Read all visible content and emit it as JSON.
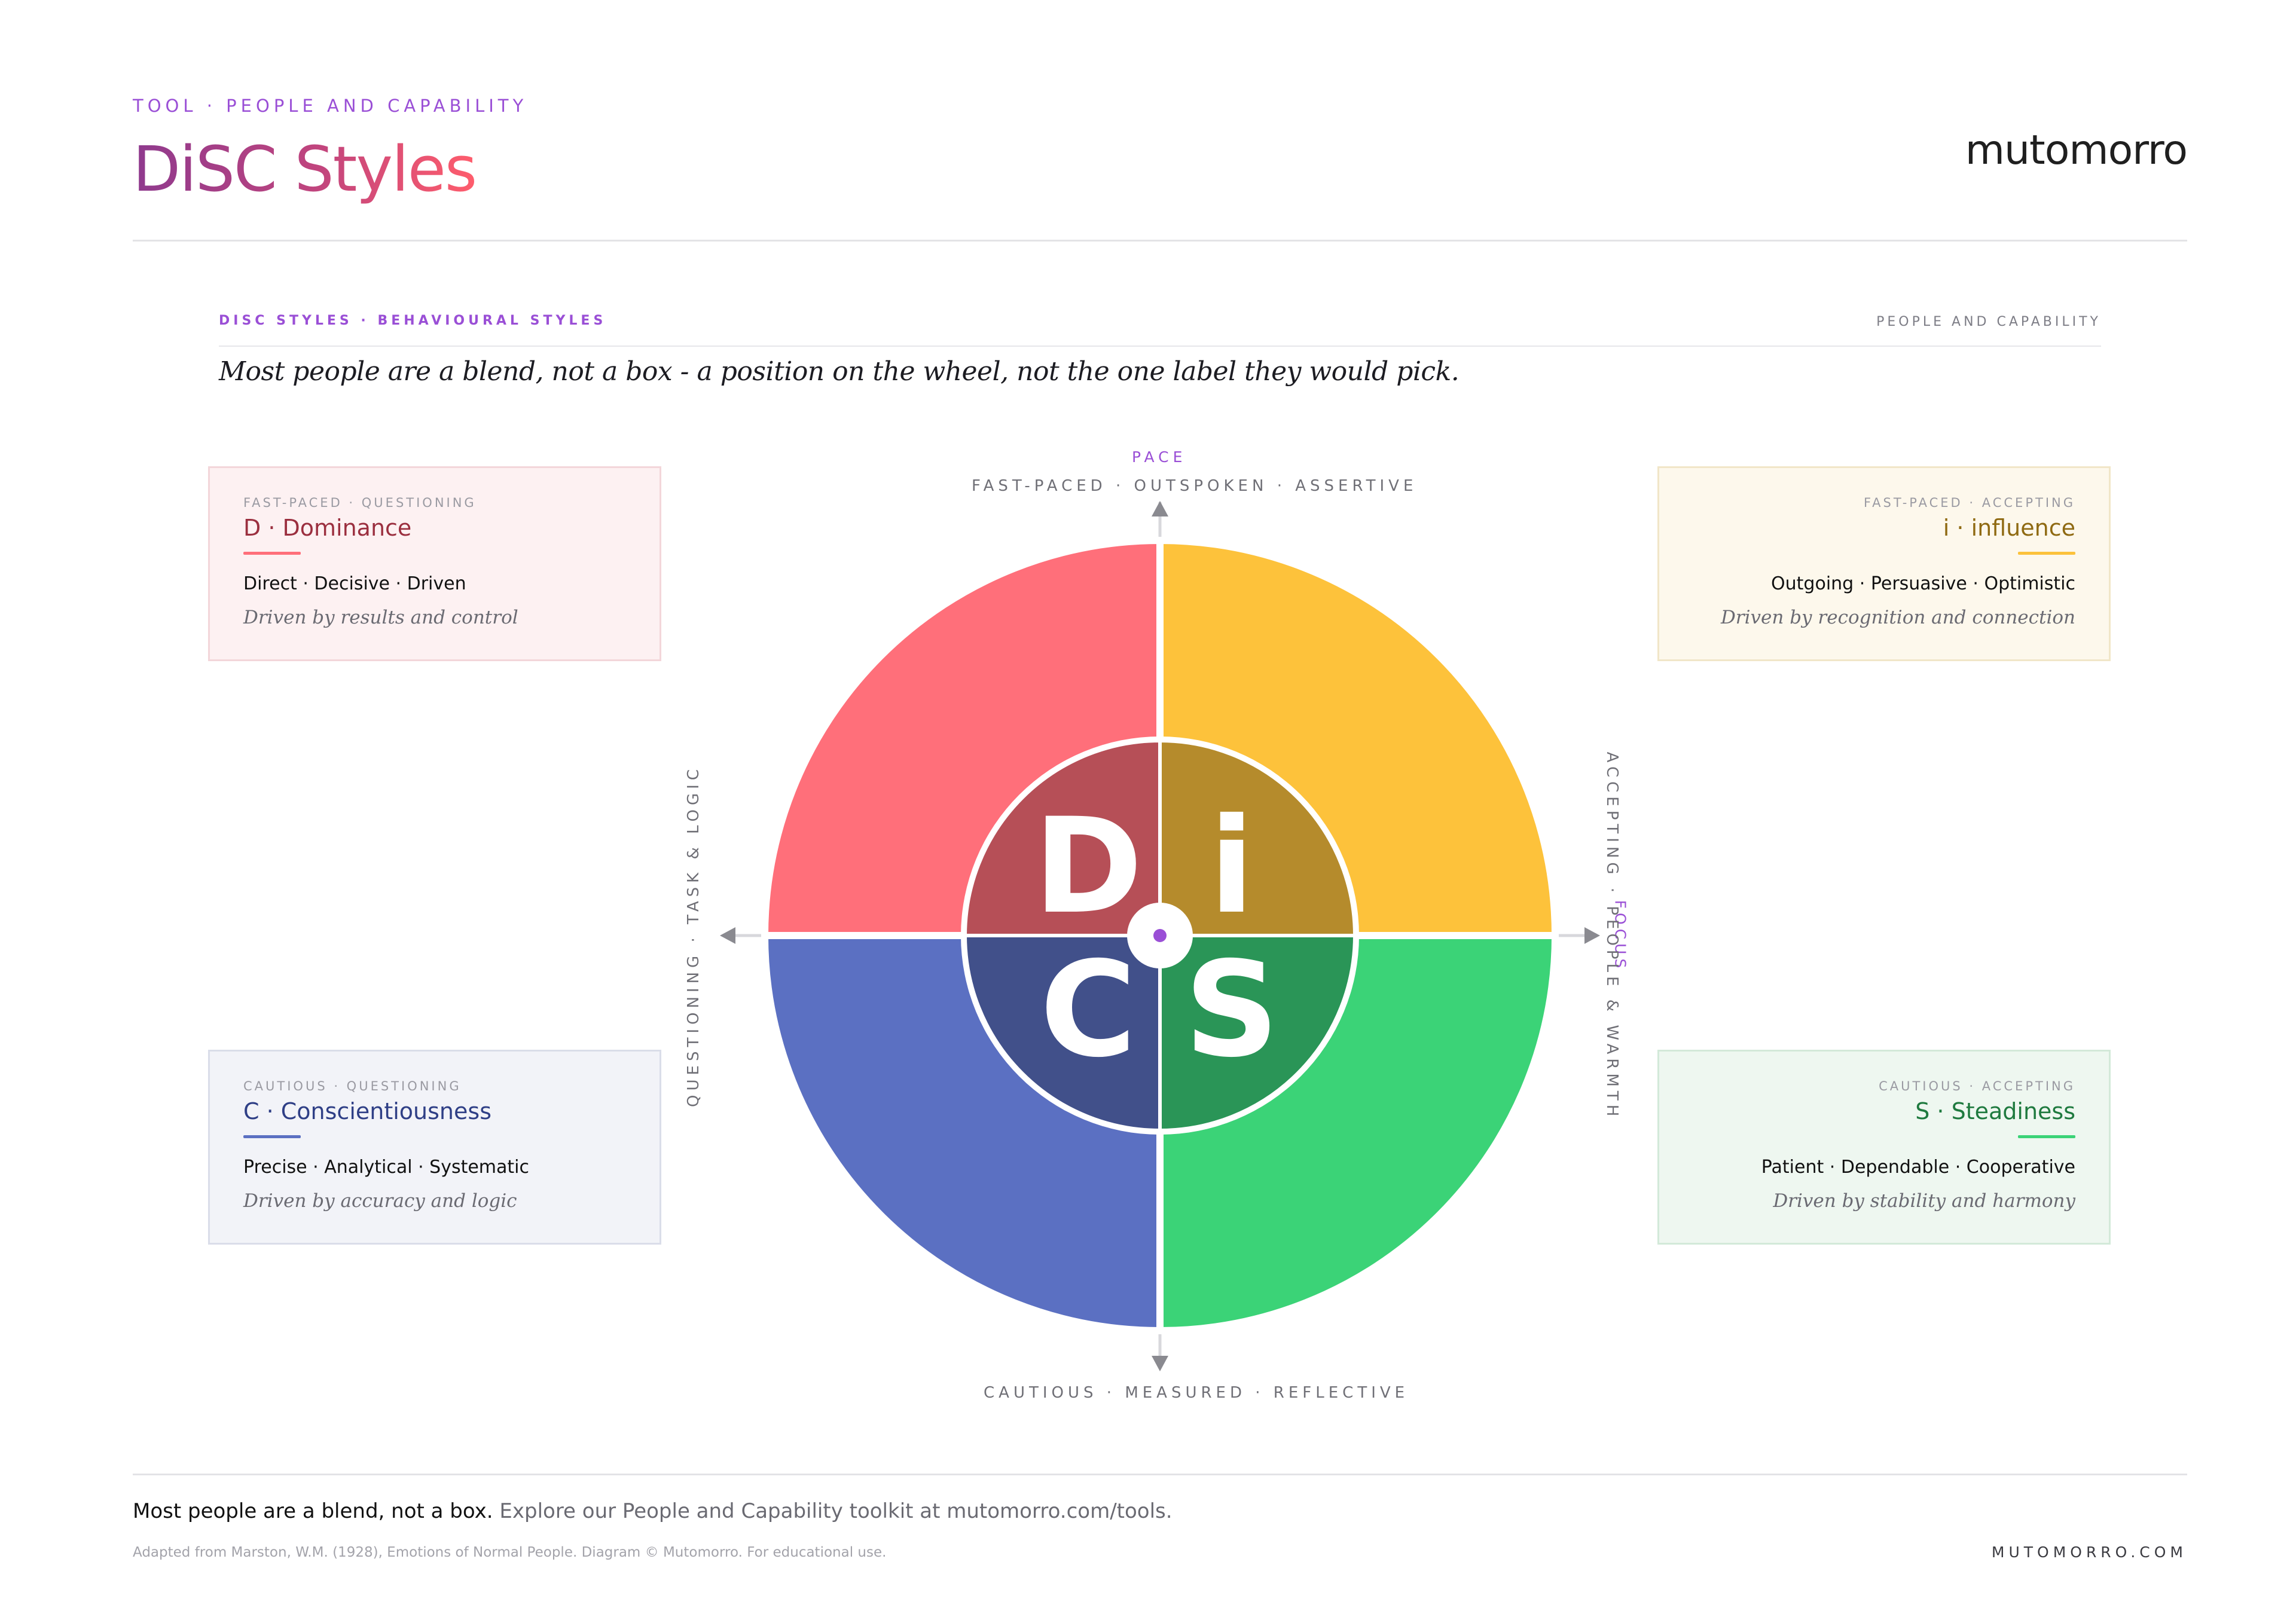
{
  "header": {
    "kicker": "TOOL · PEOPLE AND CAPABILITY",
    "title": "DiSC Styles",
    "brand": "mutomorro"
  },
  "subheader": {
    "left": "DISC STYLES · BEHAVIOURAL STYLES",
    "right": "PEOPLE AND CAPABILITY",
    "tagline": "Most people are a blend, not a box - a position on the wheel, not the one label they would pick."
  },
  "axes": {
    "pace_kicker": "PACE",
    "pace_top": "FAST-PACED · OUTSPOKEN · ASSERTIVE",
    "pace_bottom": "CAUTIOUS · MEASURED · REFLECTIVE",
    "focus_kicker": "FOCUS",
    "focus_left": "QUESTIONING · TASK & LOGIC",
    "focus_right": "ACCEPTING · PEOPLE & WARMTH"
  },
  "styles": {
    "d": {
      "kicker": "FAST-PACED · QUESTIONING",
      "title": "D · Dominance",
      "traits": "Direct · Decisive · Driven",
      "driver": "Driven by results and control",
      "letter": "D",
      "title_color": "#9b2f3f",
      "accent": "#ff6f7a",
      "outer_color": "#ff6f7a",
      "inner_color": "#b64f57"
    },
    "i": {
      "kicker": "FAST-PACED · ACCEPTING",
      "title": "i · influence",
      "traits": "Outgoing · Persuasive · Optimistic",
      "driver": "Driven by recognition and connection",
      "letter": "i",
      "title_color": "#8f6a12",
      "accent": "#fcc23b",
      "outer_color": "#fdc23b",
      "inner_color": "#b58b2c"
    },
    "c": {
      "kicker": "CAUTIOUS · QUESTIONING",
      "title": "C · Conscientiousness",
      "traits": "Precise · Analytical · Systematic",
      "driver": "Driven by accuracy and logic",
      "letter": "C",
      "title_color": "#2f3f86",
      "accent": "#5b70c2",
      "outer_color": "#5b70c2",
      "inner_color": "#41508a"
    },
    "s": {
      "kicker": "CAUTIOUS · ACCEPTING",
      "title": "S · Steadiness",
      "traits": "Patient · Dependable · Cooperative",
      "driver": "Driven by stability and harmony",
      "letter": "S",
      "title_color": "#1f7a3f",
      "accent": "#3bd377",
      "outer_color": "#3bd377",
      "inner_color": "#2a9557"
    }
  },
  "footer": {
    "strong": "Most people are a blend, not a box.",
    "rest": " Explore our People and Capability toolkit at mutomorro.com/tools.",
    "credit": "Adapted from Marston, W.M. (1928), Emotions of Normal People. Diagram © Mutomorro. For educational use.",
    "url": "MUTOMORRO.COM"
  },
  "colors": {
    "accent_purple": "#9a4fd6",
    "axis_grey": "#8a8a90"
  }
}
